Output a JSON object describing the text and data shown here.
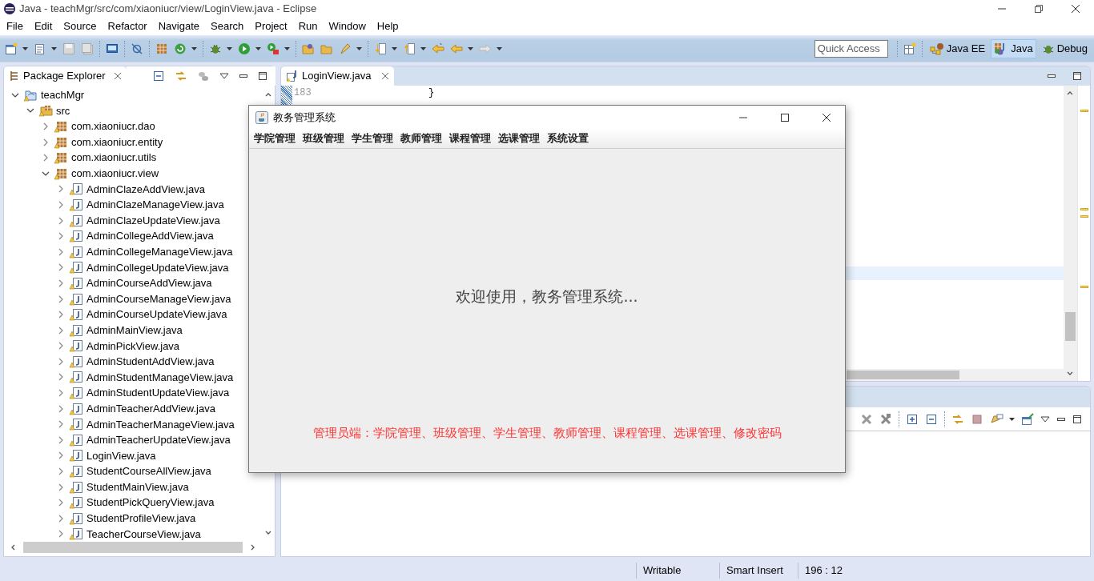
{
  "window": {
    "title": "Java - teachMgr/src/com/xiaoniucr/view/LoginView.java - Eclipse"
  },
  "menu": [
    "File",
    "Edit",
    "Source",
    "Refactor",
    "Navigate",
    "Search",
    "Project",
    "Run",
    "Window",
    "Help"
  ],
  "quick_access": {
    "placeholder": "Quick Access"
  },
  "perspectives": [
    {
      "label": "Java EE",
      "selected": false
    },
    {
      "label": "Java",
      "selected": true
    },
    {
      "label": "Debug",
      "selected": false
    }
  ],
  "package_explorer": {
    "title": "Package Explorer",
    "tree": [
      {
        "label": "teachMgr",
        "kind": "project",
        "expanded": true,
        "children": [
          {
            "label": "src",
            "kind": "folder",
            "expanded": true,
            "children": [
              {
                "label": "com.xiaoniucr.dao",
                "kind": "package",
                "expanded": false
              },
              {
                "label": "com.xiaoniucr.entity",
                "kind": "package",
                "expanded": false
              },
              {
                "label": "com.xiaoniucr.utils",
                "kind": "package",
                "expanded": false
              },
              {
                "label": "com.xiaoniucr.view",
                "kind": "package",
                "expanded": true,
                "children": [
                  {
                    "label": "AdminClazeAddView.java",
                    "kind": "file",
                    "expanded": false
                  },
                  {
                    "label": "AdminClazeManageView.java",
                    "kind": "file",
                    "expanded": false
                  },
                  {
                    "label": "AdminClazeUpdateView.java",
                    "kind": "file",
                    "expanded": false
                  },
                  {
                    "label": "AdminCollegeAddView.java",
                    "kind": "file",
                    "expanded": false
                  },
                  {
                    "label": "AdminCollegeManageView.java",
                    "kind": "file",
                    "expanded": false
                  },
                  {
                    "label": "AdminCollegeUpdateView.java",
                    "kind": "file",
                    "expanded": false
                  },
                  {
                    "label": "AdminCourseAddView.java",
                    "kind": "file",
                    "expanded": false
                  },
                  {
                    "label": "AdminCourseManageView.java",
                    "kind": "file",
                    "expanded": false
                  },
                  {
                    "label": "AdminCourseUpdateView.java",
                    "kind": "file",
                    "expanded": false
                  },
                  {
                    "label": "AdminMainView.java",
                    "kind": "file",
                    "expanded": false
                  },
                  {
                    "label": "AdminPickView.java",
                    "kind": "file",
                    "expanded": false
                  },
                  {
                    "label": "AdminStudentAddView.java",
                    "kind": "file",
                    "expanded": false
                  },
                  {
                    "label": "AdminStudentManageView.java",
                    "kind": "file",
                    "expanded": false
                  },
                  {
                    "label": "AdminStudentUpdateView.java",
                    "kind": "file",
                    "expanded": false
                  },
                  {
                    "label": "AdminTeacherAddView.java",
                    "kind": "file",
                    "expanded": false
                  },
                  {
                    "label": "AdminTeacherManageView.java",
                    "kind": "file",
                    "expanded": false
                  },
                  {
                    "label": "AdminTeacherUpdateView.java",
                    "kind": "file",
                    "expanded": false
                  },
                  {
                    "label": "LoginView.java",
                    "kind": "file",
                    "expanded": false
                  },
                  {
                    "label": "StudentCourseAllView.java",
                    "kind": "file",
                    "expanded": false
                  },
                  {
                    "label": "StudentMainView.java",
                    "kind": "file",
                    "expanded": false
                  },
                  {
                    "label": "StudentPickQueryView.java",
                    "kind": "file",
                    "expanded": false
                  },
                  {
                    "label": "StudentProfileView.java",
                    "kind": "file",
                    "expanded": false
                  },
                  {
                    "label": "TeacherCourseView.java",
                    "kind": "file",
                    "expanded": false
                  }
                ]
              }
            ]
          }
        ]
      }
    ]
  },
  "editor": {
    "tab": "LoginView.java",
    "lines": [
      {
        "number": "183",
        "code": "}"
      }
    ]
  },
  "dialog": {
    "title": "教务管理系统",
    "menu": [
      "学院管理",
      "班级管理",
      "学生管理",
      "教师管理",
      "课程管理",
      "选课管理",
      "系统设置"
    ],
    "welcome": "欢迎使用，教务管理系统...",
    "footer": "管理员端：学院管理、班级管理、学生管理、教师管理、课程管理、选课管理、修改密码"
  },
  "status_bar": [
    "Writable",
    "Smart Insert",
    "196 : 12"
  ]
}
